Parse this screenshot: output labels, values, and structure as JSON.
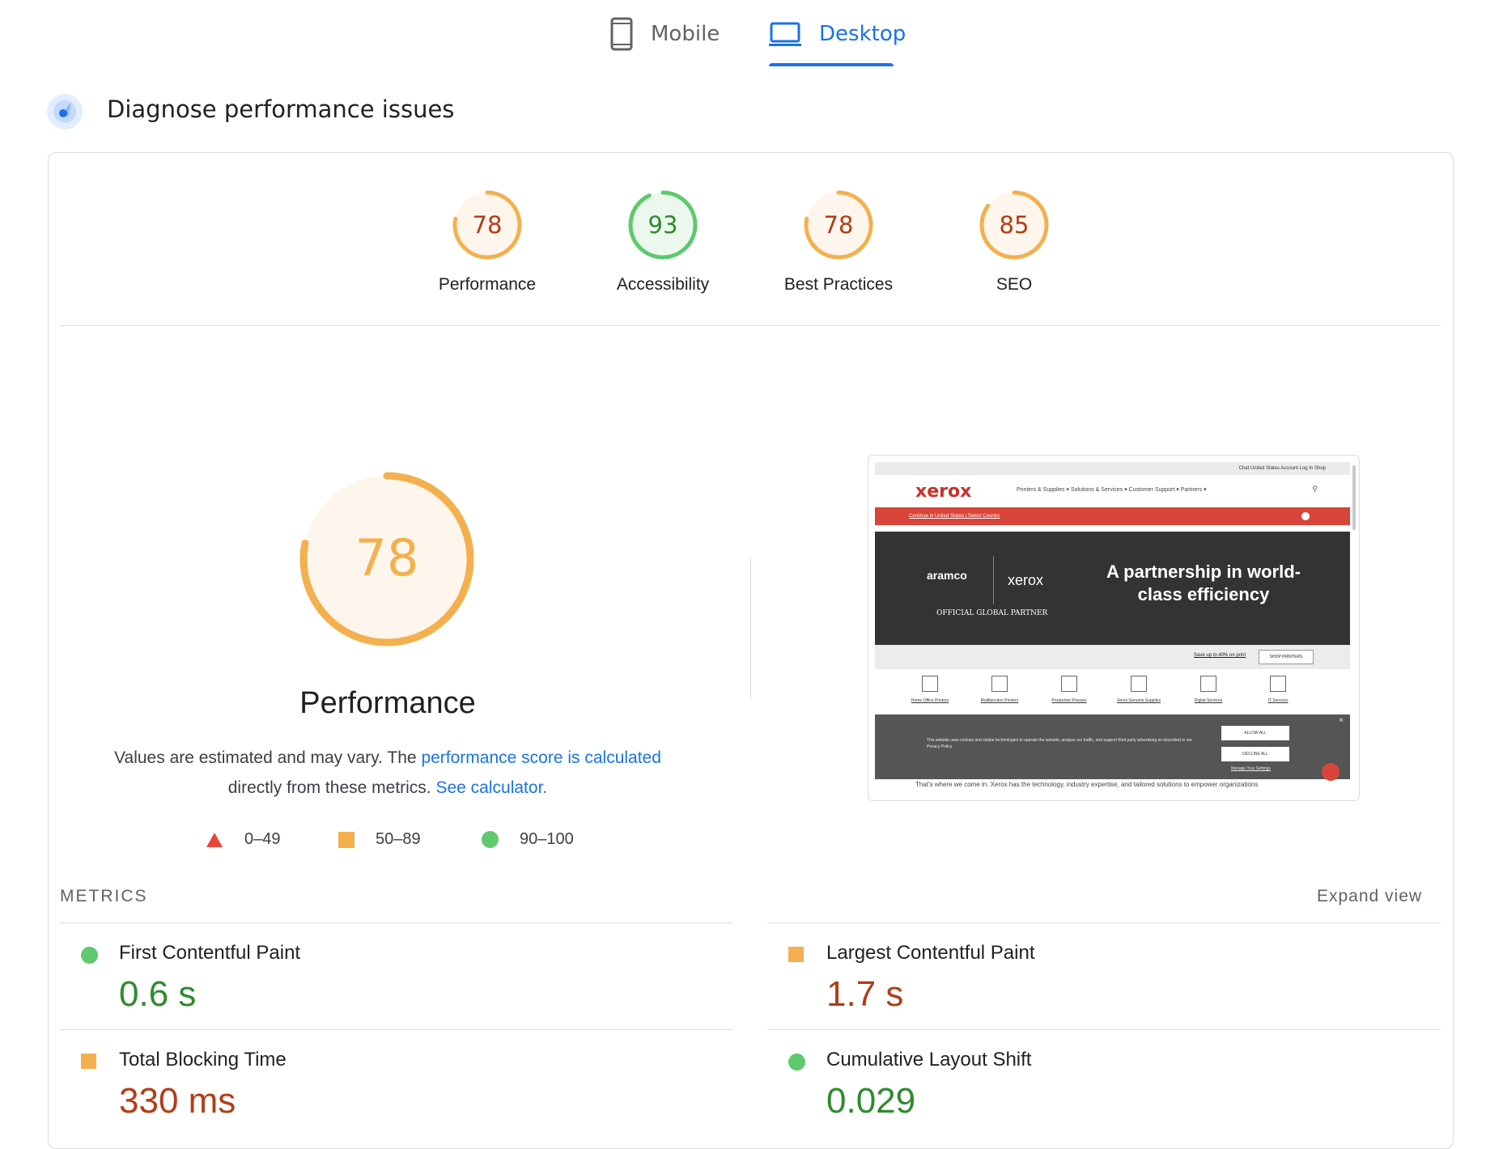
{
  "tabs": [
    {
      "label": "Mobile",
      "icon": "smartphone-icon",
      "active": false
    },
    {
      "label": "Desktop",
      "icon": "laptop-icon",
      "active": true
    }
  ],
  "section": {
    "title": "Diagnose performance issues",
    "icon": "gauge-icon"
  },
  "colors": {
    "accent": "#1a73e8",
    "average": "#f4b04f",
    "average_text": "#b23d17",
    "pass": "#5ec96e",
    "pass_text": "#2e8b2e",
    "fail": "#e8453c"
  },
  "categories": [
    {
      "label": "Performance",
      "score": 78,
      "status": "average"
    },
    {
      "label": "Accessibility",
      "score": 93,
      "status": "pass"
    },
    {
      "label": "Best Practices",
      "score": 78,
      "status": "average"
    },
    {
      "label": "SEO",
      "score": 85,
      "status": "average"
    }
  ],
  "main": {
    "score": 78,
    "title": "Performance",
    "desc_prefix": "Values are estimated and may vary. The ",
    "desc_link1": "performance score is calculated",
    "desc_middle": "directly from these metrics. ",
    "desc_link2": "See calculator."
  },
  "legend": [
    {
      "range": "0–49",
      "shape": "triangle"
    },
    {
      "range": "50–89",
      "shape": "square"
    },
    {
      "range": "90–100",
      "shape": "circle"
    }
  ],
  "screenshot": {
    "top_links": "Chat  United States  Account  Log In  Shop",
    "logo": "xerox",
    "menu": "Printers & Supplies ▾   Solutions & Services ▾   Customer Support ▾   Partners ▾",
    "banner": "Continue in United States | Select Country",
    "hero_brand": "aramco",
    "hero_brand2": "xerox",
    "hero_partner": "OFFICIAL GLOBAL PARTNER",
    "hero_headline": "A partnership in world-class efficiency",
    "promo": "Save up to 40% on print",
    "promo_btn": "SHOP PRINTERS",
    "categories": [
      "Home Office Printers",
      "Multifunction Printers",
      "Production Presses",
      "Xerox Genuine Supplies",
      "Digital Services",
      "IT Services"
    ],
    "cookie_text": "This website uses cookies and similar technologies to operate the website, analyze our traffic, and support third party advertising as described in our Privacy Policy.",
    "allow_all": "ALLOW ALL",
    "decline_all": "DECLINE ALL",
    "manage": "Manage Your Settings",
    "body_text": "That's where we come in. Xerox has the technology, industry expertise, and tailored solutions to empower organizations"
  },
  "metrics": {
    "header": "METRICS",
    "expand": "Expand view",
    "items": [
      {
        "name": "First Contentful Paint",
        "value": "0.6 s",
        "status": "pass"
      },
      {
        "name": "Largest Contentful Paint",
        "value": "1.7 s",
        "status": "average"
      },
      {
        "name": "Total Blocking Time",
        "value": "330 ms",
        "status": "average"
      },
      {
        "name": "Cumulative Layout Shift",
        "value": "0.029",
        "status": "pass"
      }
    ]
  }
}
